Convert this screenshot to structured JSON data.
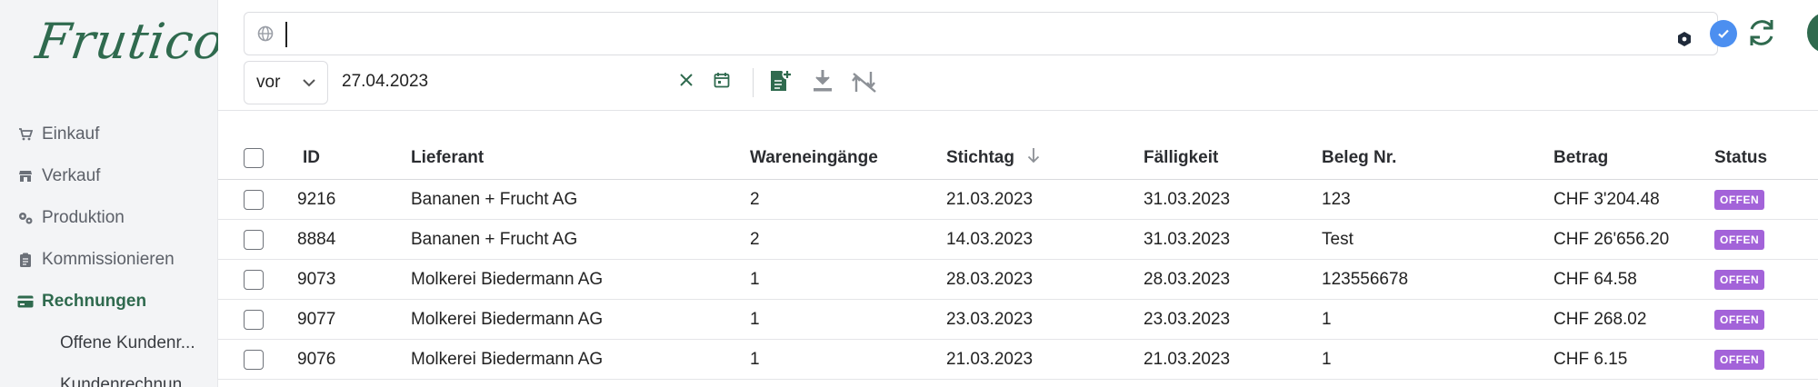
{
  "app": {
    "logo_text": "Frutico"
  },
  "sidebar": {
    "items": [
      {
        "label": "Einkauf",
        "icon": "cart-icon",
        "active": false
      },
      {
        "label": "Verkauf",
        "icon": "store-icon",
        "active": false
      },
      {
        "label": "Produktion",
        "icon": "cogs-icon",
        "active": false
      },
      {
        "label": "Kommissionieren",
        "icon": "clipboard-icon",
        "active": false
      },
      {
        "label": "Rechnungen",
        "icon": "credit-card-icon",
        "active": true
      }
    ],
    "subitems": [
      {
        "label": "Offene Kundenr..."
      },
      {
        "label": "Kundenrechnun..."
      }
    ]
  },
  "search": {
    "value": "",
    "placeholder": ""
  },
  "filter": {
    "operator": "vor",
    "date": "27.04.2023"
  },
  "table": {
    "columns": [
      "ID",
      "Lieferant",
      "Wareneingänge",
      "Stichtag",
      "Fälligkeit",
      "Beleg Nr.",
      "Betrag",
      "Status"
    ],
    "rows": [
      {
        "id": "9216",
        "supplier": "Bananen + Frucht AG",
        "receipts": "2",
        "cutoff": "21.03.2023",
        "due": "31.03.2023",
        "doc": "123",
        "amount": "CHF 3'204.48",
        "status": "OFFEN"
      },
      {
        "id": "8884",
        "supplier": "Bananen + Frucht AG",
        "receipts": "2",
        "cutoff": "14.03.2023",
        "due": "31.03.2023",
        "doc": "Test",
        "amount": "CHF 26'656.20",
        "status": "OFFEN"
      },
      {
        "id": "9073",
        "supplier": "Molkerei Biedermann AG",
        "receipts": "1",
        "cutoff": "28.03.2023",
        "due": "28.03.2023",
        "doc": "123556678",
        "amount": "CHF 64.58",
        "status": "OFFEN"
      },
      {
        "id": "9077",
        "supplier": "Molkerei Biedermann AG",
        "receipts": "1",
        "cutoff": "23.03.2023",
        "due": "23.03.2023",
        "doc": "1",
        "amount": "CHF 268.02",
        "status": "OFFEN"
      },
      {
        "id": "9076",
        "supplier": "Molkerei Biedermann AG",
        "receipts": "1",
        "cutoff": "21.03.2023",
        "due": "21.03.2023",
        "doc": "1",
        "amount": "CHF 6.15",
        "status": "OFFEN"
      }
    ]
  },
  "colors": {
    "brand": "#2f6a4e",
    "status_open": "#a363d9",
    "accent": "#4c8ff0"
  }
}
